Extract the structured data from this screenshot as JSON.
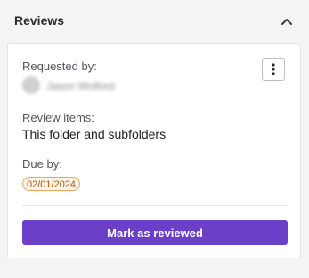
{
  "panel": {
    "title": "Reviews",
    "collapse_icon": "chevron-up-icon"
  },
  "review": {
    "requested_by_label": "Requested by:",
    "requester_name": "Jason Wolford",
    "more_icon": "vertical-ellipsis-icon",
    "items_label": "Review items:",
    "items_value": "This folder and subfolders",
    "due_label": "Due by:",
    "due_date": "02/01/2024",
    "mark_button_label": "Mark as reviewed"
  },
  "colors": {
    "accent": "#6c3fc8",
    "due_badge_border": "#f0a35c",
    "due_badge_text": "#b4570a",
    "due_badge_bg": "#fff4e6"
  }
}
